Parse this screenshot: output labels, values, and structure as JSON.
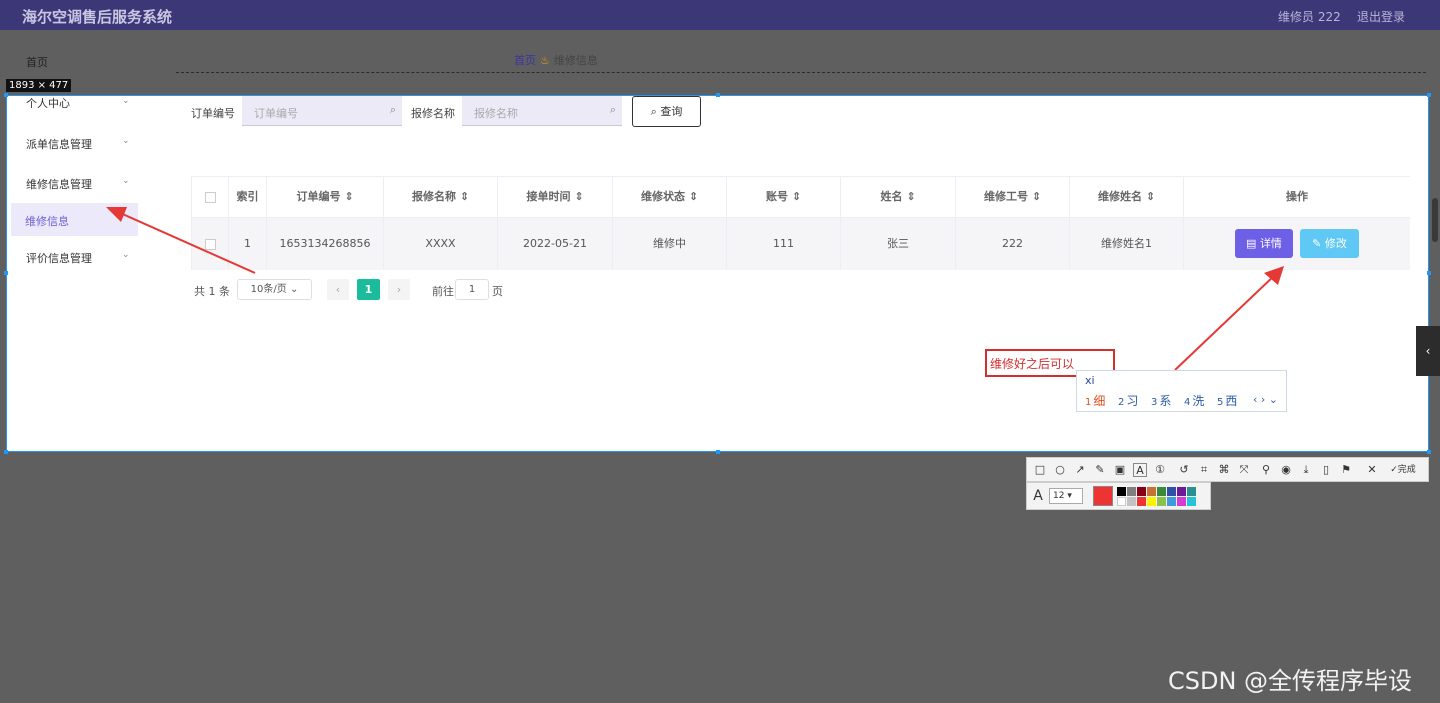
{
  "header": {
    "title": "海尔空调售后服务系统",
    "user": "维修员 222",
    "logout": "退出登录"
  },
  "menu": {
    "home": "首页",
    "items": [
      {
        "label": "个人中心"
      },
      {
        "label": "派单信息管理"
      },
      {
        "label": "维修信息管理"
      },
      {
        "label": "维修信息",
        "active": true
      },
      {
        "label": "评价信息管理"
      }
    ],
    "chevron": "chevron-down-icon"
  },
  "breadcrumb": {
    "home": "首页",
    "separator_icon": "pineapple-icon",
    "current": "维修信息"
  },
  "dim_label": "1893 × 477",
  "search": {
    "order_label": "订单编号",
    "order_placeholder": "订单编号",
    "name_label": "报修名称",
    "name_placeholder": "报修名称",
    "query_button": "查询"
  },
  "table": {
    "columns": [
      "索引",
      "订单编号",
      "报修名称",
      "接单时间",
      "维修状态",
      "账号",
      "姓名",
      "维修工号",
      "维修姓名",
      "操作"
    ],
    "rows": [
      {
        "index": "1",
        "order_no": "1653134268856",
        "repair_name": "XXXX",
        "time": "2022-05-21",
        "status": "维修中",
        "account": "111",
        "name": "张三",
        "worker_id": "222",
        "worker_name": "维修姓名1"
      }
    ],
    "detail_button": "详情",
    "edit_button": "修改"
  },
  "pagination": {
    "total": "共 1 条",
    "page_size": "10条/页",
    "current": "1",
    "goto_label": "前往",
    "goto_value": "1",
    "page_unit": "页"
  },
  "annotation": {
    "text": "维修好之后可以",
    "ime_pinyin": "xi",
    "candidates": [
      {
        "num": "1",
        "char": "细"
      },
      {
        "num": "2",
        "char": "习"
      },
      {
        "num": "3",
        "char": "系"
      },
      {
        "num": "4",
        "char": "洗"
      },
      {
        "num": "5",
        "char": "西"
      }
    ]
  },
  "toolbar": {
    "font_size": "12",
    "done_label": "完成",
    "active_color": "#ee3333"
  },
  "watermark": "CSDN @全传程序毕设",
  "colors": {
    "header": "#3c3777",
    "accent": "#6d5fe6",
    "edit": "#5fc8f4",
    "page_current": "#1abc9c",
    "arrow": "#e53935"
  }
}
